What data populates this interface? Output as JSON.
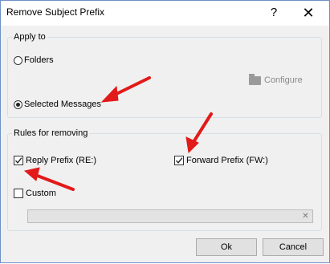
{
  "window": {
    "title": "Remove Subject Prefix",
    "help_label": "?",
    "close_label": "✕"
  },
  "apply_to": {
    "legend": "Apply to",
    "folders_label": "Folders",
    "selected_messages_label": "Selected Messages",
    "selected": "Selected Messages",
    "configure_label": "Configure"
  },
  "rules": {
    "legend": "Rules for removing",
    "reply_prefix_label": "Reply Prefix (RE:)",
    "reply_prefix_checked": true,
    "forward_prefix_label": "Forward Prefix (FW:)",
    "forward_prefix_checked": true,
    "custom_label": "Custom",
    "custom_checked": false,
    "custom_value": ""
  },
  "buttons": {
    "ok_label": "Ok",
    "cancel_label": "Cancel"
  },
  "annotation_color": "#e21a1a"
}
